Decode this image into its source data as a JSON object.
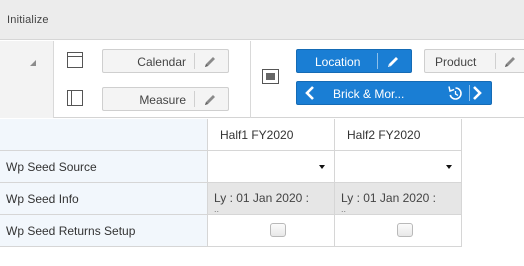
{
  "title": "Initialize",
  "colors": {
    "accent": "#1a7ed4",
    "row_header_bg": "#f2f7fc",
    "readonly_cell_bg": "#e6e6e6"
  },
  "toolbar": {
    "collapse_icon": "triangle-collapse-icon",
    "rows_layout_icon": "rows-layout-icon",
    "columns_layout_icon": "columns-layout-icon",
    "page_layout_icon": "page-layout-icon",
    "row_dimension": {
      "label": "Calendar",
      "icon": "pencil-icon"
    },
    "column_dimension": {
      "label": "Measure",
      "icon": "pencil-icon"
    },
    "page_dimensions": [
      {
        "label": "Location",
        "active": true,
        "icon": "pencil-icon"
      },
      {
        "label": "Product",
        "active": false,
        "icon": "pencil-icon"
      }
    ],
    "member_selector": {
      "label": "Brick & Mor...",
      "prev_icon": "chevron-left-icon",
      "next_icon": "chevron-right-icon",
      "hierarchy_icon": "hierarchy-reset-icon"
    }
  },
  "grid": {
    "columns": [
      "Half1 FY2020",
      "Half2 FY2020"
    ],
    "rows": [
      {
        "label": "Wp Seed Source",
        "type": "dropdown",
        "values": [
          "",
          ""
        ]
      },
      {
        "label": "Wp Seed Info",
        "type": "text",
        "values": [
          "Ly : 01 Jan 2020 :",
          "Ly : 01 Jan 2020 :"
        ]
      },
      {
        "label": "Wp Seed Returns Setup",
        "type": "checkbox",
        "values": [
          false,
          false
        ]
      }
    ]
  }
}
